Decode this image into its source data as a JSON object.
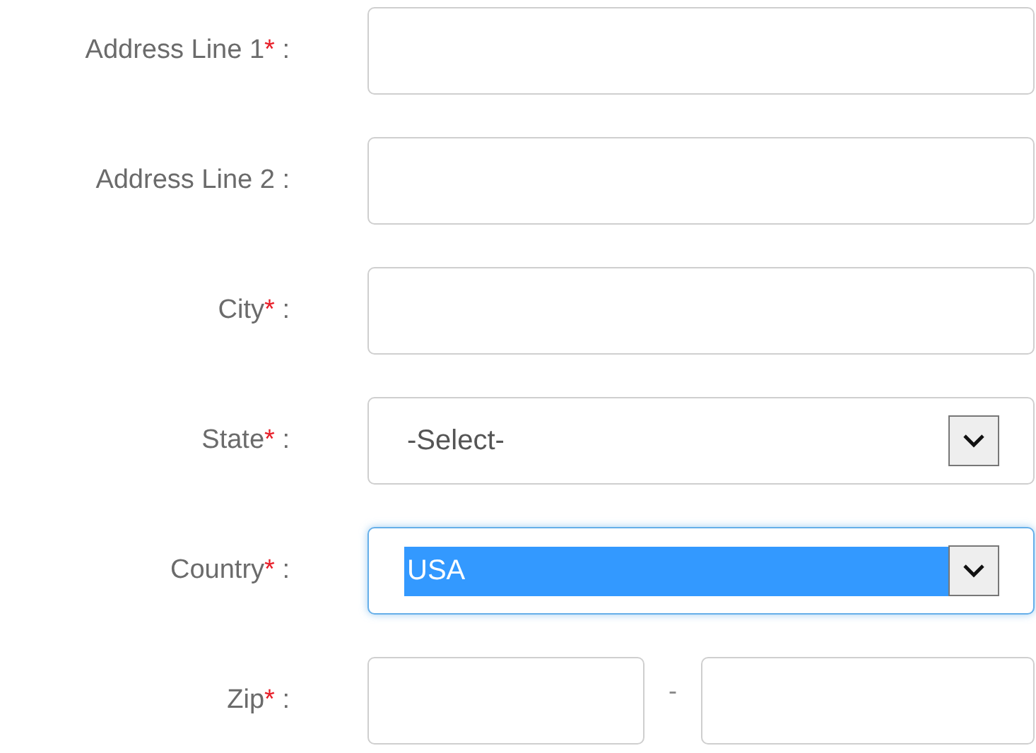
{
  "fields": [
    {
      "kind": "text",
      "label": "Address Line 1",
      "required_mark": "*",
      "separator": ":"
    },
    {
      "kind": "text",
      "label": "Address Line 2",
      "separator": ":"
    },
    {
      "kind": "text",
      "label": "City",
      "required_mark": "*",
      "separator": ":"
    },
    {
      "kind": "select",
      "label": "State",
      "required_mark": "*",
      "separator": ":",
      "value": "-Select-",
      "highlighted": false
    },
    {
      "kind": "select",
      "label": "Country",
      "required_mark": "*",
      "separator": ":",
      "value": "USA",
      "highlighted": true
    },
    {
      "kind": "zip",
      "label": "Zip",
      "required_mark": "*",
      "separator": ":",
      "dash": "-"
    }
  ]
}
